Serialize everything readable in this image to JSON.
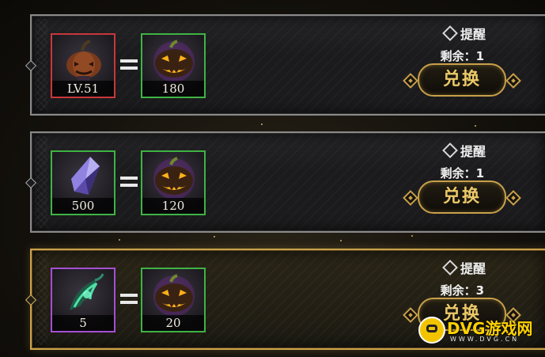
{
  "offers": [
    {
      "input": {
        "name": "pumpkin-head-item",
        "label": "LV.51",
        "border": "#c8373a"
      },
      "output": {
        "name": "jack-o-lantern-token",
        "label": "180",
        "border": "#3fb344"
      },
      "remind_label": "提醒",
      "remain_label": "剩余：1",
      "exchange_label": "兑换",
      "highlighted": false
    },
    {
      "input": {
        "name": "purple-crystal-item",
        "label": "500",
        "border": "#3fb344"
      },
      "output": {
        "name": "jack-o-lantern-token",
        "label": "120",
        "border": "#3fb344"
      },
      "remind_label": "提醒",
      "remain_label": "剩余：1",
      "exchange_label": "兑换",
      "highlighted": false
    },
    {
      "input": {
        "name": "green-claw-item",
        "label": "5",
        "border": "#a44fd4"
      },
      "output": {
        "name": "jack-o-lantern-token",
        "label": "20",
        "border": "#3fb344"
      },
      "remind_label": "提醒",
      "remain_label": "剩余：3",
      "exchange_label": "兑换",
      "highlighted": true
    }
  ],
  "watermark": {
    "brand": "DVG游戏网",
    "url": "WWW.DVG.CN"
  },
  "colors": {
    "gold": "#caa24a",
    "button_text": "#ecc968",
    "panel_border": "#8a8a8a"
  }
}
